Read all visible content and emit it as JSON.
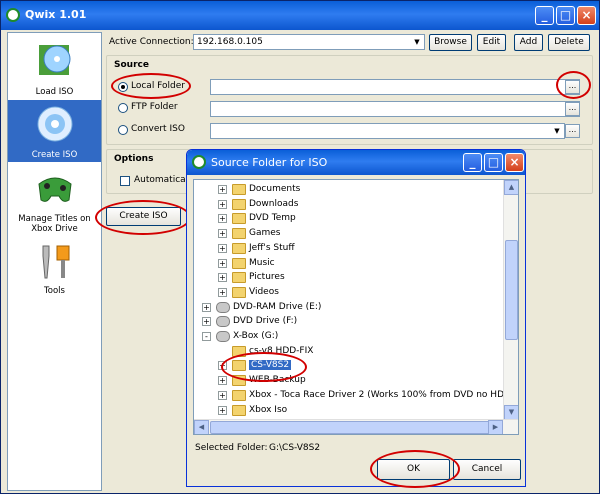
{
  "app": {
    "title": "Qwix 1.01"
  },
  "sidebar": {
    "items": [
      {
        "label": "Load ISO",
        "icon": "load-iso-icon"
      },
      {
        "label": "Create ISO",
        "icon": "disc-icon",
        "active": true
      },
      {
        "label": "Manage Titles on Xbox Drive",
        "icon": "controller-icon"
      },
      {
        "label": "Tools",
        "icon": "tools-icon"
      }
    ]
  },
  "connection": {
    "label": "Active Connection:",
    "value": "192.168.0.105",
    "browse": "Browse",
    "edit": "Edit",
    "add": "Add",
    "delete": "Delete"
  },
  "source": {
    "title": "Source",
    "local": "Local Folder",
    "ftp": "FTP Folder",
    "convert": "Convert ISO",
    "ellipsis": "..."
  },
  "options": {
    "title": "Options",
    "automatically": "Automatically"
  },
  "create_button": "Create ISO",
  "dialog": {
    "title": "Source Folder for ISO",
    "tree": [
      {
        "label": "Documents",
        "type": "folder",
        "indent": 2,
        "exp": "+"
      },
      {
        "label": "Downloads",
        "type": "folder",
        "indent": 2,
        "exp": "+"
      },
      {
        "label": "DVD Temp",
        "type": "folder",
        "indent": 2,
        "exp": "+"
      },
      {
        "label": "Games",
        "type": "folder",
        "indent": 2,
        "exp": "+"
      },
      {
        "label": "Jeff's Stuff",
        "type": "folder",
        "indent": 2,
        "exp": "+"
      },
      {
        "label": "Music",
        "type": "folder",
        "indent": 2,
        "exp": "+"
      },
      {
        "label": "Pictures",
        "type": "folder",
        "indent": 2,
        "exp": "+"
      },
      {
        "label": "Videos",
        "type": "folder",
        "indent": 2,
        "exp": "+"
      },
      {
        "label": "DVD-RAM Drive (E:)",
        "type": "drive",
        "indent": 1,
        "exp": "+"
      },
      {
        "label": "DVD Drive (F:)",
        "type": "drive",
        "indent": 1,
        "exp": "+"
      },
      {
        "label": "X-Box (G:)",
        "type": "drive",
        "indent": 1,
        "exp": "-"
      },
      {
        "label": "cs-v8 HDD-FIX",
        "type": "folder",
        "indent": 2,
        "exp": ""
      },
      {
        "label": "CS-V8S2",
        "type": "folder",
        "indent": 2,
        "exp": "+",
        "selected": true
      },
      {
        "label": "WEB-Backup",
        "type": "folder",
        "indent": 2,
        "exp": "+"
      },
      {
        "label": "Xbox - Toca Race Driver 2 (Works 100% from DVD no HD",
        "type": "folder",
        "indent": 2,
        "exp": "+"
      },
      {
        "label": "Xbox Iso",
        "type": "folder",
        "indent": 2,
        "exp": "+"
      }
    ],
    "selected_label": "Selected Folder:",
    "selected_value": "G:\\CS-V8S2",
    "ok": "OK",
    "cancel": "Cancel"
  },
  "colors": {
    "accent": "#316ac5",
    "highlight": "#d20000"
  }
}
